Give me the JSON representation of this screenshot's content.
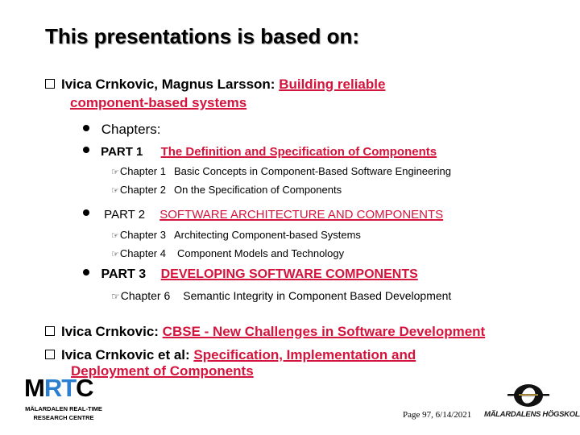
{
  "slide": {
    "title": "This presentations is based on:",
    "references": [
      {
        "author": "Ivica Crnkovic, Magnus Larsson: ",
        "link_line1": "Building reliable",
        "link_line2": "component-based systems"
      },
      {
        "author": "Ivica Crnkovic: ",
        "link": "CBSE - New Challenges  in Software Development"
      },
      {
        "author": "Ivica Crnkovic et al: ",
        "link_line1": "Specification, Implementation and",
        "link_line2": "Deployment of Components"
      }
    ],
    "chapters_label": "Chapters:",
    "parts": [
      {
        "label": "PART 1",
        "title": "The Definition and Specification of Components ",
        "chapters": [
          {
            "num": "Chapter 1",
            "title": "Basic Concepts in Component-Based Software Engineering"
          },
          {
            "num": "Chapter 2",
            "title": "On the Specification of Components"
          }
        ]
      },
      {
        "label": "PART 2",
        "title": "SOFTWARE ARCHITECTURE AND COMPONENTS",
        "chapters": [
          {
            "num": "Chapter 3",
            "title": "Architecting Component-based Systems"
          },
          {
            "num": "Chapter 4",
            "title": "Component Models and Technology"
          }
        ]
      },
      {
        "label": "PART 3",
        "title": "DEVELOPING SOFTWARE COMPONENTS",
        "chapters": [
          {
            "num": "Chapter 6",
            "title": "Semantic Integrity in Component Based Development"
          }
        ]
      }
    ],
    "footer": {
      "page_info": "Page 97, 6/14/2021",
      "mrtc_logo": {
        "letters_black_1": "M",
        "letters_blue": "RT",
        "letters_black_2": "C",
        "line1": "MÄLARDALEN REAL-TIME",
        "line2": "RESEARCH CENTRE"
      },
      "mdh_logo": {
        "text": "MÄLARDALENS HÖGSKOLA"
      }
    },
    "colors": {
      "link": "#d4143c",
      "mrtc_blue": "#2b7fd0"
    },
    "icons": {
      "hand": "☞"
    }
  }
}
